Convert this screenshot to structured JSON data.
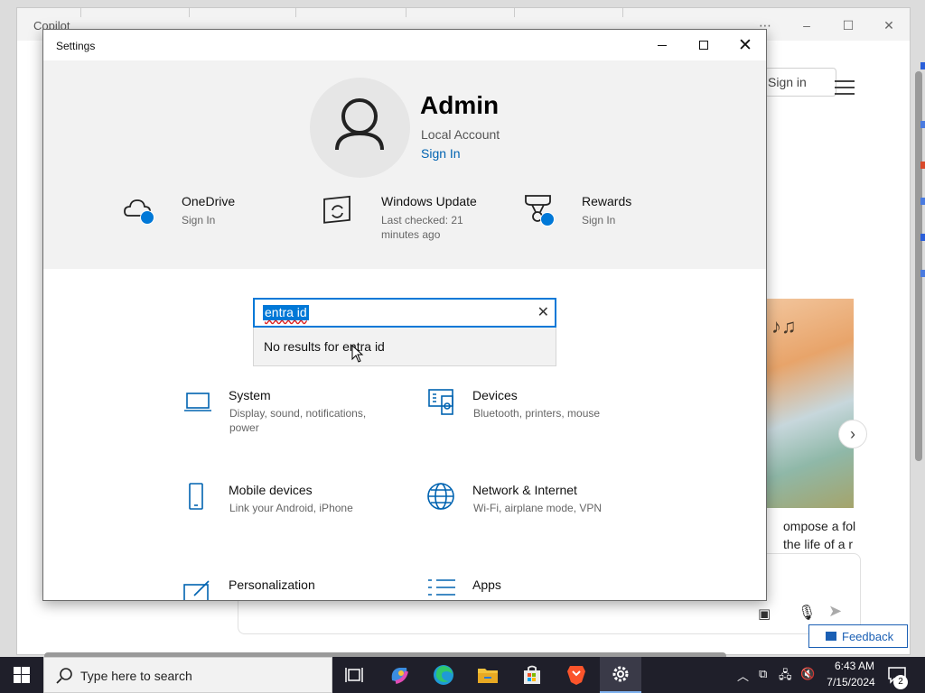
{
  "background_window": {
    "title": "Copilot",
    "signin_label": "Sign in",
    "caption_line1": "ompose a foll",
    "caption_line2": "the life of a r",
    "feedback_label": "Feedback"
  },
  "settings": {
    "window_title": "Settings",
    "user": {
      "name": "Admin",
      "account_type": "Local Account",
      "signin_link": "Sign In"
    },
    "quick_links": [
      {
        "title": "OneDrive",
        "subtitle": "Sign In",
        "icon": "cloud-icon"
      },
      {
        "title": "Windows Update",
        "subtitle": "Last checked: 21 minutes ago",
        "icon": "update-icon"
      },
      {
        "title": "Rewards",
        "subtitle": "Sign In",
        "icon": "trophy-icon"
      }
    ],
    "search": {
      "value": "entra id",
      "no_results": "No results for entra id"
    },
    "categories": [
      {
        "title": "System",
        "desc": "Display, sound, notifications, power",
        "icon": "laptop-icon"
      },
      {
        "title": "Devices",
        "desc": "Bluetooth, printers, mouse",
        "icon": "devices-icon"
      },
      {
        "title": "Mobile devices",
        "desc": "Link your Android, iPhone",
        "icon": "phone-icon"
      },
      {
        "title": "Network & Internet",
        "desc": "Wi-Fi, airplane mode, VPN",
        "icon": "globe-icon"
      },
      {
        "title": "Personalization",
        "desc": "",
        "icon": "personalization-icon"
      },
      {
        "title": "Apps",
        "desc": "",
        "icon": "apps-list-icon"
      }
    ]
  },
  "taskbar": {
    "search_placeholder": "Type here to search",
    "time": "6:43 AM",
    "date": "7/15/2024",
    "notification_count": "2",
    "apps": [
      "task-view-icon",
      "copilot-icon",
      "edge-icon",
      "file-explorer-icon",
      "store-icon",
      "brave-icon",
      "settings-gear-icon"
    ]
  },
  "colors": {
    "accent": "#0078d7",
    "link": "#0063b1",
    "taskbar": "#1f1f2a",
    "header_bg": "#f2f2f2"
  }
}
